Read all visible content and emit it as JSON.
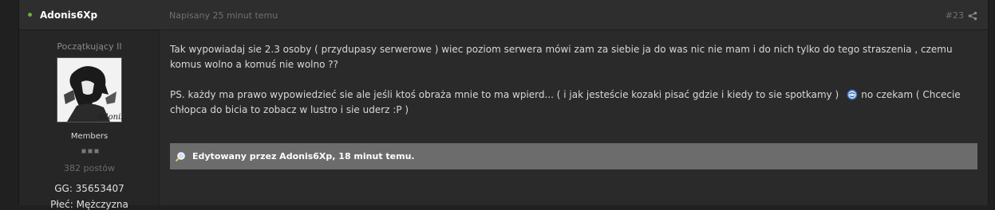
{
  "post": {
    "author": "Adonis6Xp",
    "date": "Napisany 25 minut temu",
    "number": "#23",
    "online_color": "#6fb03a"
  },
  "author_info": {
    "rank_title": "Początkujący II",
    "avatar_signature": "Adonis",
    "group": "Members",
    "post_count": "382 postów",
    "gg": "GG: 35653407",
    "sex": "Płeć: Mężczyzna"
  },
  "body": {
    "paragraph1": "Tak wypowiadaj sie 2.3 osoby ( przydupasy serwerowe ) wiec poziom serwera mówi zam za siebie ja do was nic nie mam i do nich tylko do tego straszenia , czemu komus wolno a komuś nie wolno ??",
    "paragraph2_before": "PS. każdy ma prawo wypowiedzieć sie ale jeśli ktoś obraża mnie to ma wpierd... ( i jak jesteście kozaki pisać gdzie i kiedy to sie spotkamy )",
    "paragraph2_after": "no czekam   ( Chcecie chłopca  do bicia to zobacz w lustro i sie uderz  :P )"
  },
  "edit_notice": "Edytowany przez Adonis6Xp, 18 minut temu.",
  "icons": {
    "online": "online-dot-icon",
    "share": "share-icon",
    "emoticon": "smiley-icon",
    "edit": "edit-magnifier-icon"
  }
}
